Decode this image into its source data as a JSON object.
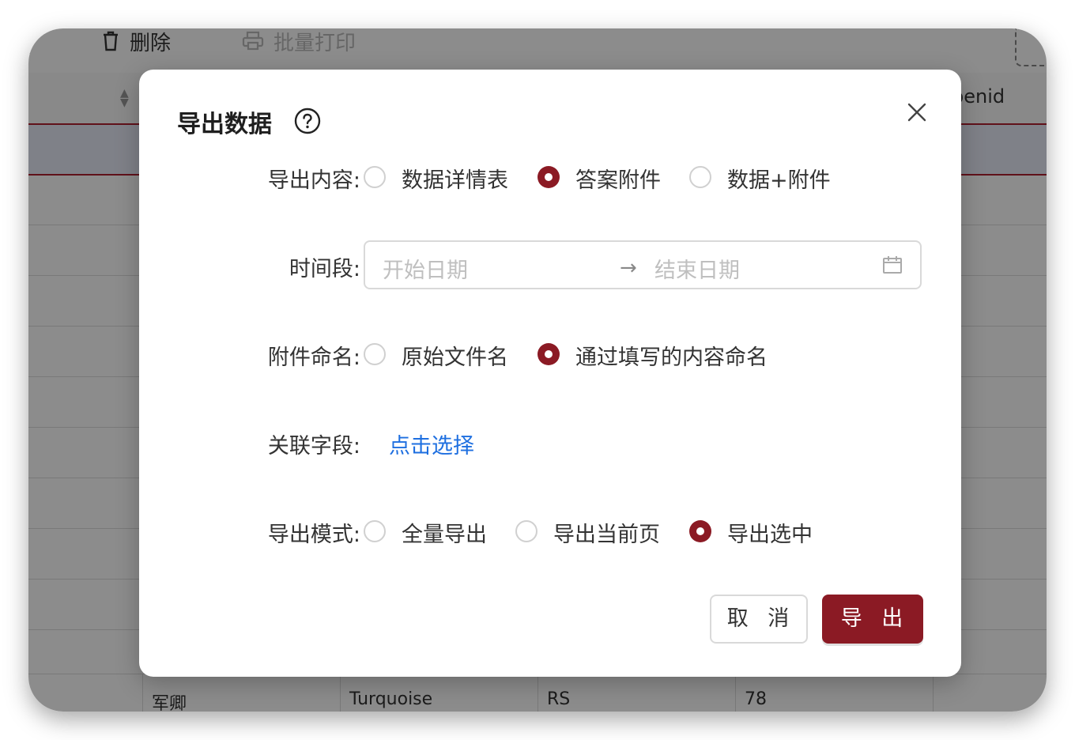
{
  "toolbar": {
    "delete_label": "删除",
    "batch_print_label": "批量打印"
  },
  "table": {
    "visible_header": "penid",
    "bottom_row": [
      "军卿",
      "Turquoise",
      "RS",
      "78"
    ]
  },
  "dialog": {
    "title": "导出数据",
    "export_content": {
      "label": "导出内容:",
      "options": [
        "数据详情表",
        "答案附件",
        "数据+附件"
      ],
      "selected": "答案附件"
    },
    "time_range": {
      "label": "时间段:",
      "start_placeholder": "开始日期",
      "end_placeholder": "结束日期"
    },
    "attachment_naming": {
      "label": "附件命名:",
      "options": [
        "原始文件名",
        "通过填写的内容命名"
      ],
      "selected": "通过填写的内容命名"
    },
    "linked_fields": {
      "label": "关联字段:",
      "link_text": "点击选择"
    },
    "export_mode": {
      "label": "导出模式:",
      "options": [
        "全量导出",
        "导出当前页",
        "导出选中"
      ],
      "selected": "导出选中"
    },
    "cancel_label": "取 消",
    "export_label": "导 出"
  },
  "colors": {
    "accent": "#8b1a24",
    "link": "#1e6fe0",
    "overlay": "rgba(0,0,0,0.45)"
  },
  "icons": [
    "trash-icon",
    "printer-icon",
    "help-circle-icon",
    "close-icon",
    "calendar-icon",
    "sort-icon"
  ]
}
